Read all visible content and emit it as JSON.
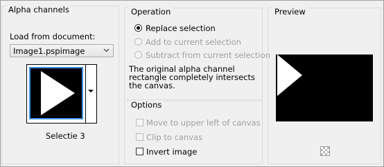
{
  "alpha_channels": {
    "title": "Alpha channels",
    "load_label": "Load from document:",
    "document_select": {
      "value": "Image1.pspimage",
      "icon": "chevron-down-icon"
    },
    "channel_name": "Selectie 3"
  },
  "operation": {
    "title": "Operation",
    "options": [
      {
        "label": "Replace selection",
        "selected": true,
        "enabled": true
      },
      {
        "label": "Add to current selection",
        "selected": false,
        "enabled": false
      },
      {
        "label": "Subtract from current selection",
        "selected": false,
        "enabled": false
      }
    ],
    "description": "The original alpha channel rectangle completely intersects the canvas."
  },
  "options": {
    "title": "Options",
    "items": [
      {
        "label": "Move to upper left of canvas",
        "checked": false,
        "enabled": false
      },
      {
        "label": "Clip to canvas",
        "checked": false,
        "enabled": false
      },
      {
        "label": "Invert image",
        "checked": false,
        "enabled": true
      }
    ]
  },
  "preview": {
    "title": "Preview",
    "transparency_icon": "checkerboard-icon"
  }
}
